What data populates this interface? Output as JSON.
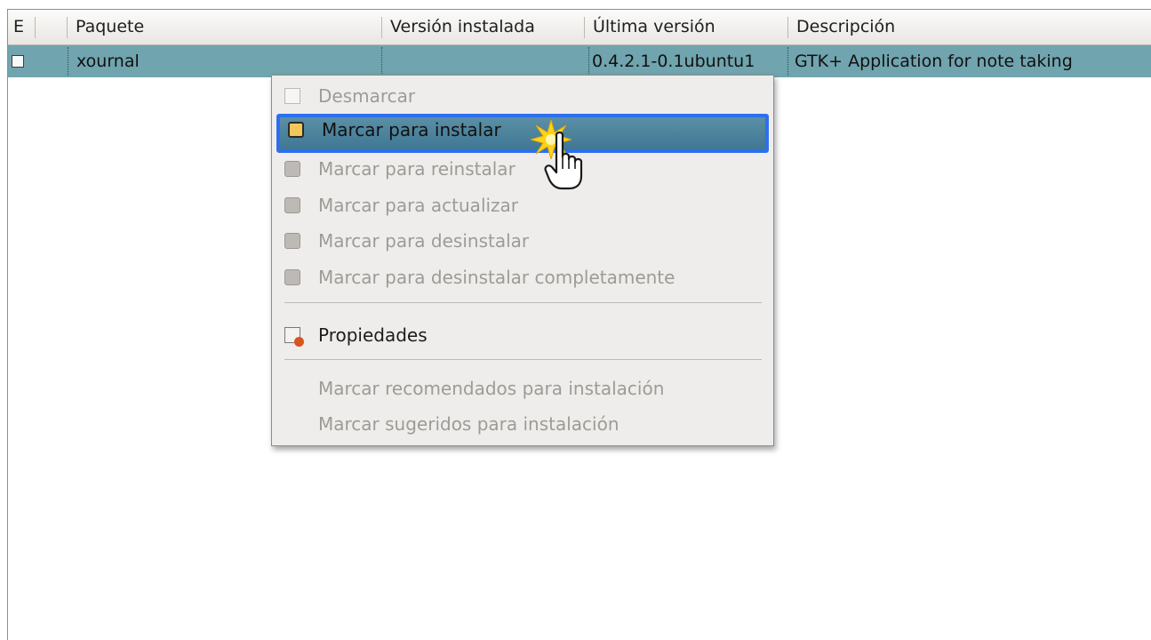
{
  "table": {
    "columns": [
      {
        "key": "status",
        "label": "E"
      },
      {
        "key": "package",
        "label": "Paquete"
      },
      {
        "key": "installed_version",
        "label": "Versión instalada"
      },
      {
        "key": "latest_version",
        "label": "Última versión"
      },
      {
        "key": "description",
        "label": "Descripción"
      }
    ],
    "rows": [
      {
        "checked": false,
        "package": "xournal",
        "installed_version": "",
        "latest_version": "0.4.2.1-0.1ubuntu1",
        "description": "GTK+ Application for note taking"
      }
    ]
  },
  "context_menu": {
    "items": [
      {
        "label": "Desmarcar",
        "icon": "checkbox-icon",
        "enabled": false
      },
      {
        "label": "Marcar para instalar",
        "icon": "install-icon",
        "enabled": true,
        "highlighted": true
      },
      {
        "label": "Marcar para reinstalar",
        "icon": "reinstall-icon",
        "enabled": false
      },
      {
        "label": "Marcar para actualizar",
        "icon": "upgrade-icon",
        "enabled": false
      },
      {
        "label": "Marcar para desinstalar",
        "icon": "remove-icon",
        "enabled": false
      },
      {
        "label": "Marcar para desinstalar completamente",
        "icon": "purge-icon",
        "enabled": false
      }
    ],
    "properties": {
      "label": "Propiedades",
      "icon": "properties-icon",
      "enabled": true
    },
    "extra_items": [
      {
        "label": "Marcar recomendados para instalación",
        "enabled": false
      },
      {
        "label": "Marcar sugeridos para instalación",
        "enabled": false
      }
    ]
  },
  "colors": {
    "selected_row": "#70a4ae",
    "menu_highlight": "#3f7793",
    "highlight_border": "#2d6ff0"
  }
}
